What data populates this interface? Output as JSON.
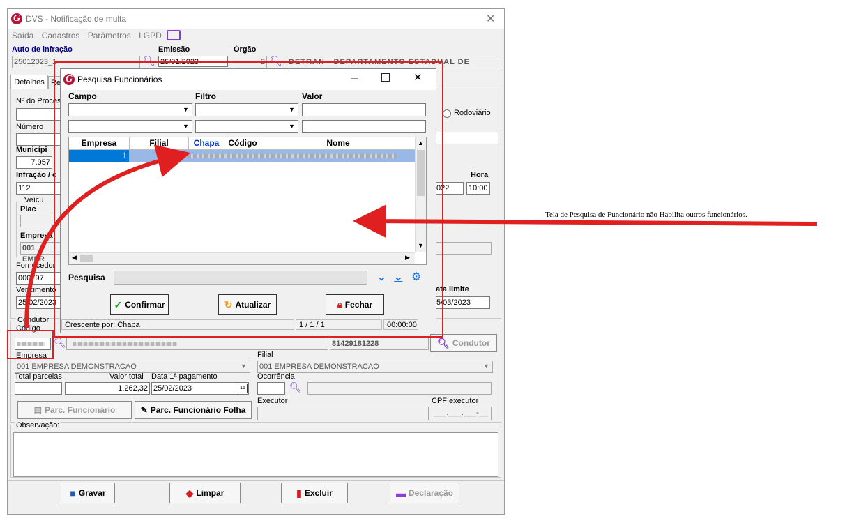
{
  "window": {
    "title": "DVS - Notificação de multa"
  },
  "menu": [
    "Saída",
    "Cadastros",
    "Parâmetros",
    "LGPD"
  ],
  "header": {
    "auto_label": "Auto de infração",
    "auto_value": "25012023_1",
    "emissao_label": "Emissão",
    "emissao_value": "25/01/2023",
    "orgao_label": "Órgão",
    "orgao_code": "2",
    "orgao_name": "DETRAN - DEPARTAMENTO ESTADUAL DE TRANS"
  },
  "tabs": [
    "Detalhes",
    "Re"
  ],
  "form": {
    "nprocesso_label": "Nº do Proces",
    "rodoviario_label": "Rodoviário",
    "numero_label": "Número",
    "municipio_label": "Municípi",
    "municipio_value": "7.957",
    "infracao_label": "Infração / c",
    "infracao_value": "112",
    "hora_label": "Hora",
    "hora_value": "10:00",
    "date_partial": "022",
    "veiculo_label": "Veícu",
    "placa_label": "Plac",
    "empresa_label_partial": "Empresa",
    "empresa_value_partial": "001 EMPR",
    "fornecedor_label": "Fornecedor",
    "fornecedor_value": "000797",
    "vencimento_label": "Vencimento",
    "vencimento_value": "25/02/2023",
    "data_limite_label": "ata limite",
    "data_limite_value": "5/03/2023"
  },
  "condutor": {
    "group_label": "Condutor",
    "codigo_label": "Código",
    "phone_value": "81429181228",
    "condutor_button": "Condutor",
    "empresa_label": "Empresa",
    "empresa_value": "001 EMPRESA DEMONSTRACAO",
    "filial_label": "Filial",
    "filial_value": "001 EMPRESA DEMONSTRACAO",
    "total_parcelas_label": "Total parcelas",
    "valor_total_label": "Valor total",
    "valor_total_value": "1.262,32",
    "data_pagamento_label": "Data 1ª pagamento",
    "data_pagamento_value": "25/02/2023",
    "ocorrencia_label": "Ocorrência",
    "executor_label": "Executor",
    "cpf_label": "CPF executor",
    "cpf_value": "___.___.___-__",
    "parc_func_button": "Parc. Funcionário",
    "parc_folha_button": "Parc. Funcionário Folha"
  },
  "observacao_label": "Observação:",
  "footer_buttons": [
    "Gravar",
    "Limpar",
    "Excluir",
    "Declaração"
  ],
  "dialog": {
    "title": "Pesquisa Funcionários",
    "campo_label": "Campo",
    "filtro_label": "Filtro",
    "valor_label": "Valor",
    "columns": [
      "Empresa",
      "Filial",
      "Chapa",
      "Código",
      "Nome"
    ],
    "row": {
      "empresa": "1"
    },
    "pesquisa_label": "Pesquisa",
    "buttons": [
      "Confirmar",
      "Atualizar",
      "Fechar"
    ],
    "status": {
      "sort": "Crescente por: Chapa",
      "pages": "1 / 1 / 1",
      "time": "00:00:00"
    }
  },
  "annotation": "Tela de Pesquisa de Funcionário não Habilita outros funcionários.",
  "colors": {
    "accent_red": "#e02020",
    "brand": "#b4173a",
    "purple_icon": "#7b3fd6",
    "selection": "#0078d7"
  }
}
